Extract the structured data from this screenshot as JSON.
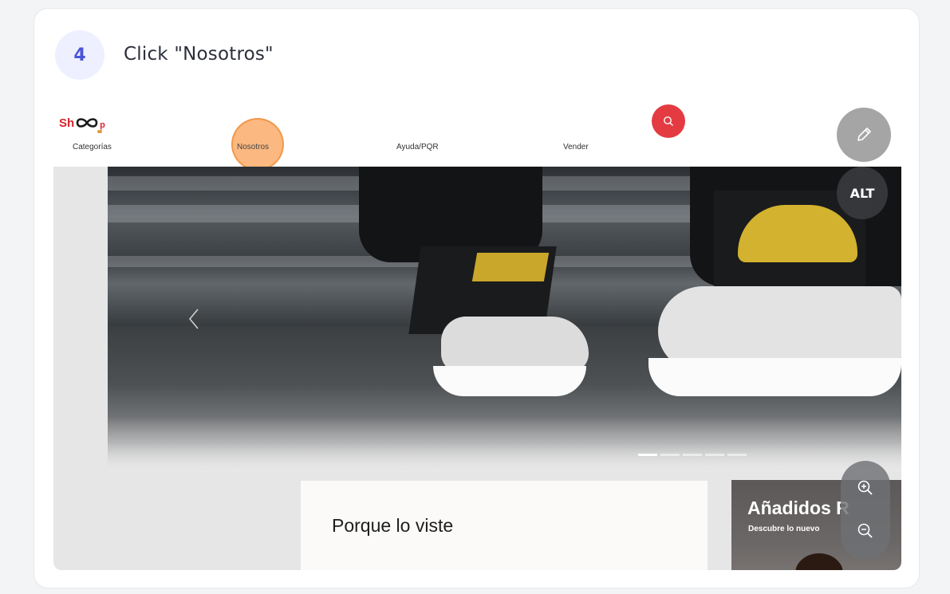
{
  "step": {
    "number": "4",
    "title": "Click \"Nosotros\""
  },
  "shop": {
    "logo": {
      "prefix": "Sh",
      "suffix": "p"
    },
    "nav": {
      "categorias": "Categorías",
      "nosotros": "Nosotros",
      "ayuda": "Ayuda/PQR",
      "vender": "Vender"
    },
    "search_icon": "search-icon",
    "hero": {
      "slides_total": 5,
      "active_slide": 1
    },
    "porque_title": "Porque lo viste",
    "anadidos_title": "Añadidos Recientes",
    "anadidos_visible_title": "Añadidos R",
    "anadidos_sub": "Descubre lo nuevo"
  },
  "overlay": {
    "edit_icon": "pencil-icon",
    "alt_label": "ALT",
    "zoom_in_icon": "zoom-in-icon",
    "zoom_out_icon": "zoom-out-icon"
  },
  "colors": {
    "accent": "#4b55d8",
    "brand_red": "#d7252e",
    "search_red": "#e43b42",
    "highlight_orange": "#faa45c"
  }
}
